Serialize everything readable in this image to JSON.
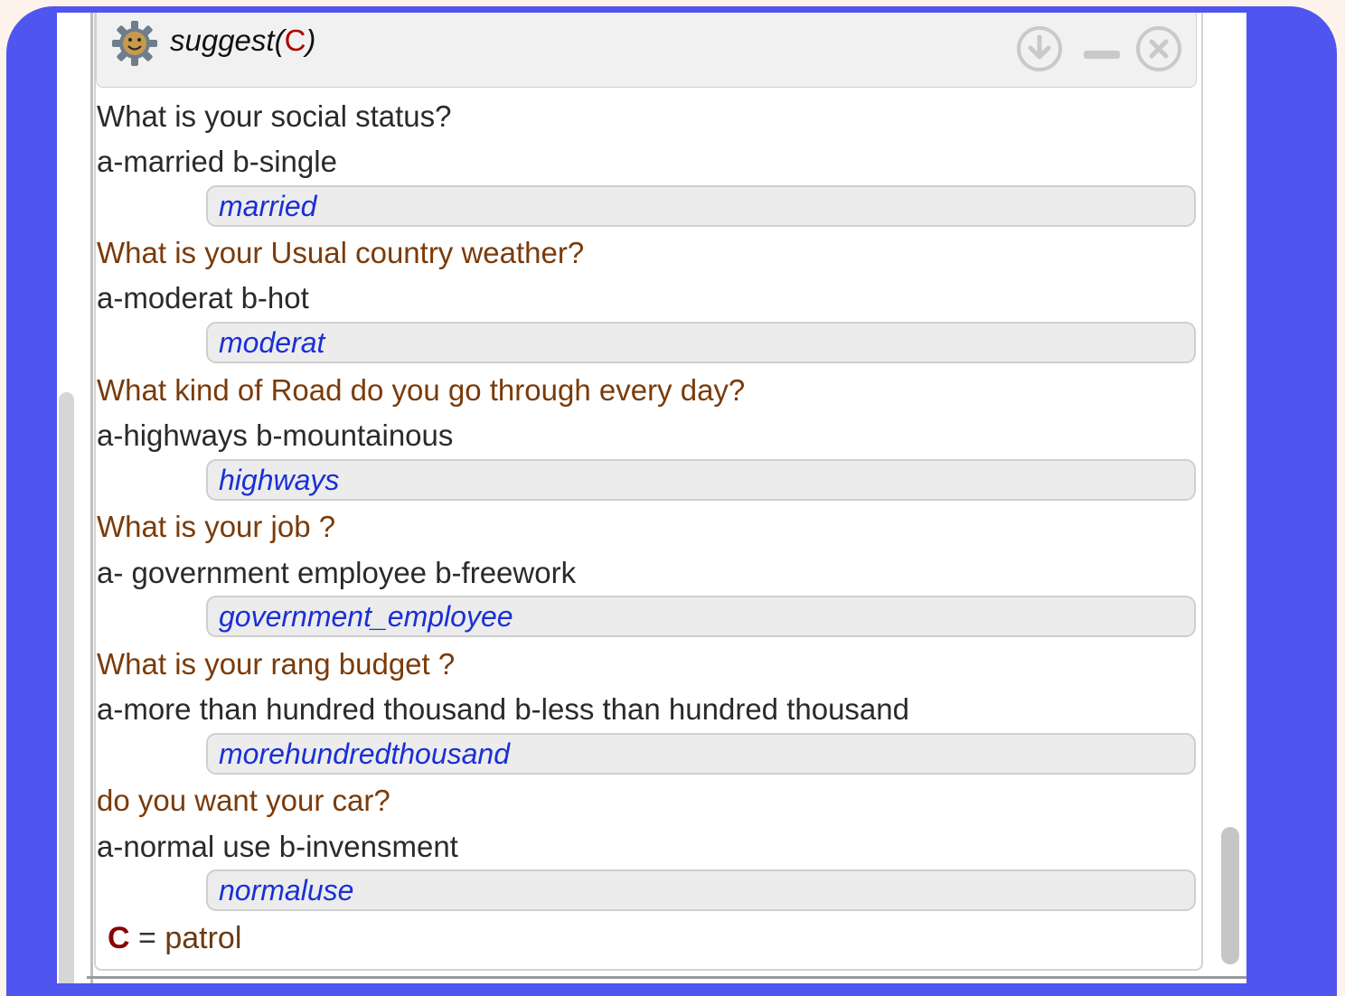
{
  "window": {
    "title_func": "suggest(",
    "title_arg": "C",
    "title_close": ")",
    "icons": [
      "smiley-gear-icon",
      "download-icon",
      "minimize-icon",
      "close-icon"
    ]
  },
  "questions": [
    {
      "question": "What is your social status?",
      "options": "a-married b-single",
      "answer": "married"
    },
    {
      "question": "What is your Usual country weather?",
      "options": "a-moderat b-hot",
      "answer": "moderat"
    },
    {
      "question": "What kind of Road do you go through every day?",
      "options": "a-highways b-mountainous",
      "answer": "highways"
    },
    {
      "question": "What is your job ?",
      "options": "a- government employee b-freework",
      "answer": "government_employee"
    },
    {
      "question": "What is your rang budget ?",
      "options": "a-more than hundred thousand b-less than hundred thousand",
      "answer": "morehundredthousand"
    },
    {
      "question": "do you want your car?",
      "options": "a-normal use b-invensment",
      "answer": "normaluse"
    }
  ],
  "result": {
    "variable": "C",
    "equals": "=",
    "value": "patrol"
  },
  "colors": {
    "accent_frame": "#4f55ef",
    "question_text": "#7a3b0a",
    "answer_text": "#1a2fd6",
    "variable": "#8b0000"
  }
}
